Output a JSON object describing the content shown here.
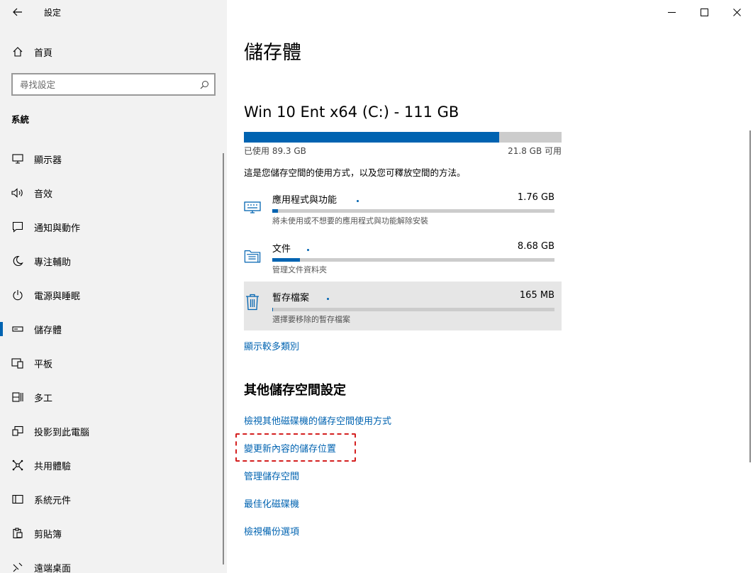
{
  "window": {
    "title": "設定"
  },
  "sidebar": {
    "home_label": "首頁",
    "search_placeholder": "尋找設定",
    "section": "系統",
    "items": [
      {
        "label": "顯示器",
        "icon": "monitor-icon"
      },
      {
        "label": "音效",
        "icon": "speaker-icon"
      },
      {
        "label": "通知與動作",
        "icon": "notification-icon"
      },
      {
        "label": "專注輔助",
        "icon": "moon-icon"
      },
      {
        "label": "電源與睡眠",
        "icon": "power-icon"
      },
      {
        "label": "儲存體",
        "icon": "storage-icon",
        "active": true
      },
      {
        "label": "平板",
        "icon": "tablet-icon"
      },
      {
        "label": "多工",
        "icon": "multitasking-icon"
      },
      {
        "label": "投影到此電腦",
        "icon": "projecting-icon"
      },
      {
        "label": "共用體驗",
        "icon": "shared-experiences-icon"
      },
      {
        "label": "系統元件",
        "icon": "system-components-icon"
      },
      {
        "label": "剪貼簿",
        "icon": "clipboard-icon"
      },
      {
        "label": "遠端桌面",
        "icon": "remote-desktop-icon"
      }
    ]
  },
  "main": {
    "title": "儲存體",
    "drive": {
      "name": "Win 10 Ent x64 (C:) - 111 GB",
      "used_label": "已使用 89.3 GB",
      "free_label": "21.8 GB 可用",
      "used_fraction": 0.804
    },
    "description": "這是您儲存空間的使用方式，以及您可釋放空間的方法。",
    "categories": [
      {
        "name": "應用程式與功能",
        "size": "1.76 GB",
        "sub": "將未使用或不想要的應用程式與功能解除安裝",
        "fraction": 0.02,
        "icon": "apps-keyboard-icon"
      },
      {
        "name": "文件",
        "size": "8.68 GB",
        "sub": "管理文件資料夾",
        "fraction": 0.098,
        "icon": "documents-folder-icon"
      },
      {
        "name": "暫存檔案",
        "size": "165 MB",
        "sub": "選擇要移除的暫存檔案",
        "fraction": 0.002,
        "icon": "trash-icon"
      }
    ],
    "show_more": "顯示較多類別",
    "other_heading": "其他儲存空間設定",
    "links": {
      "view_other_drives": "檢視其他磁碟機的儲存空間使用方式",
      "change_save_location": "變更新內容的儲存位置",
      "manage_spaces": "管理儲存空間",
      "optimize_drives": "最佳化磁碟機",
      "backup_options": "檢視備份選項"
    }
  },
  "colors": {
    "accent": "#0063b1",
    "sidebar_bg": "#f2f2f2",
    "highlight_dash": "#d42020"
  }
}
